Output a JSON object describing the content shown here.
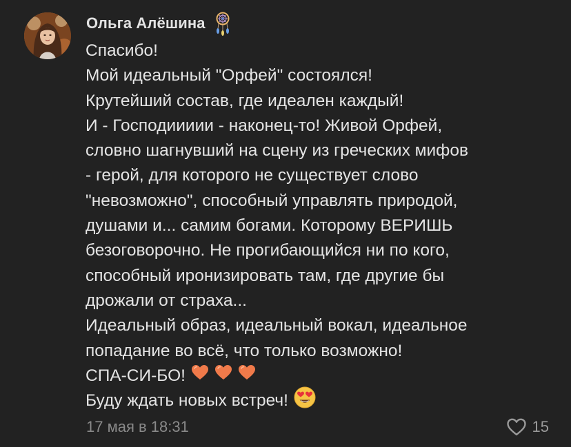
{
  "comment": {
    "author": "Ольга Алёшина",
    "status_emoji_icon": "dreamcatcher-icon",
    "text_lines": [
      "Спасибо!",
      "Мой идеальный \"Орфей\" состоялся!",
      "Крутейший состав, где идеален каждый!",
      "И - Господиииии - наконец-то! Живой Орфей,",
      "словно шагнувший на сцену из греческих мифов",
      "- герой, для которого не существует слово",
      "\"невозможно\", способный управлять природой,",
      "душами и... самим богами. Которому ВЕРИШЬ",
      "безоговорочно. Не прогибающийся ни по кого,",
      "способный иронизировать там, где другие бы",
      "дрожали от страха...",
      "Идеальный образ, идеальный вокал, идеальное",
      "попадание во всё, что только возможно!",
      "СПА-СИ-БО!",
      "Буду ждать новых встреч!"
    ],
    "inline_emojis": {
      "line_13": [
        "orange-heart-icon",
        "orange-heart-icon",
        "orange-heart-icon"
      ],
      "line_14": [
        "heart-eyes-face-icon"
      ]
    },
    "timestamp": "17 мая в 18:31",
    "like_count": "15",
    "like_icon": "heart-outline-icon",
    "colors": {
      "background": "#222222",
      "text": "#e4e4e4",
      "muted": "#8a8a8a",
      "heart": "#f07a4a"
    }
  }
}
